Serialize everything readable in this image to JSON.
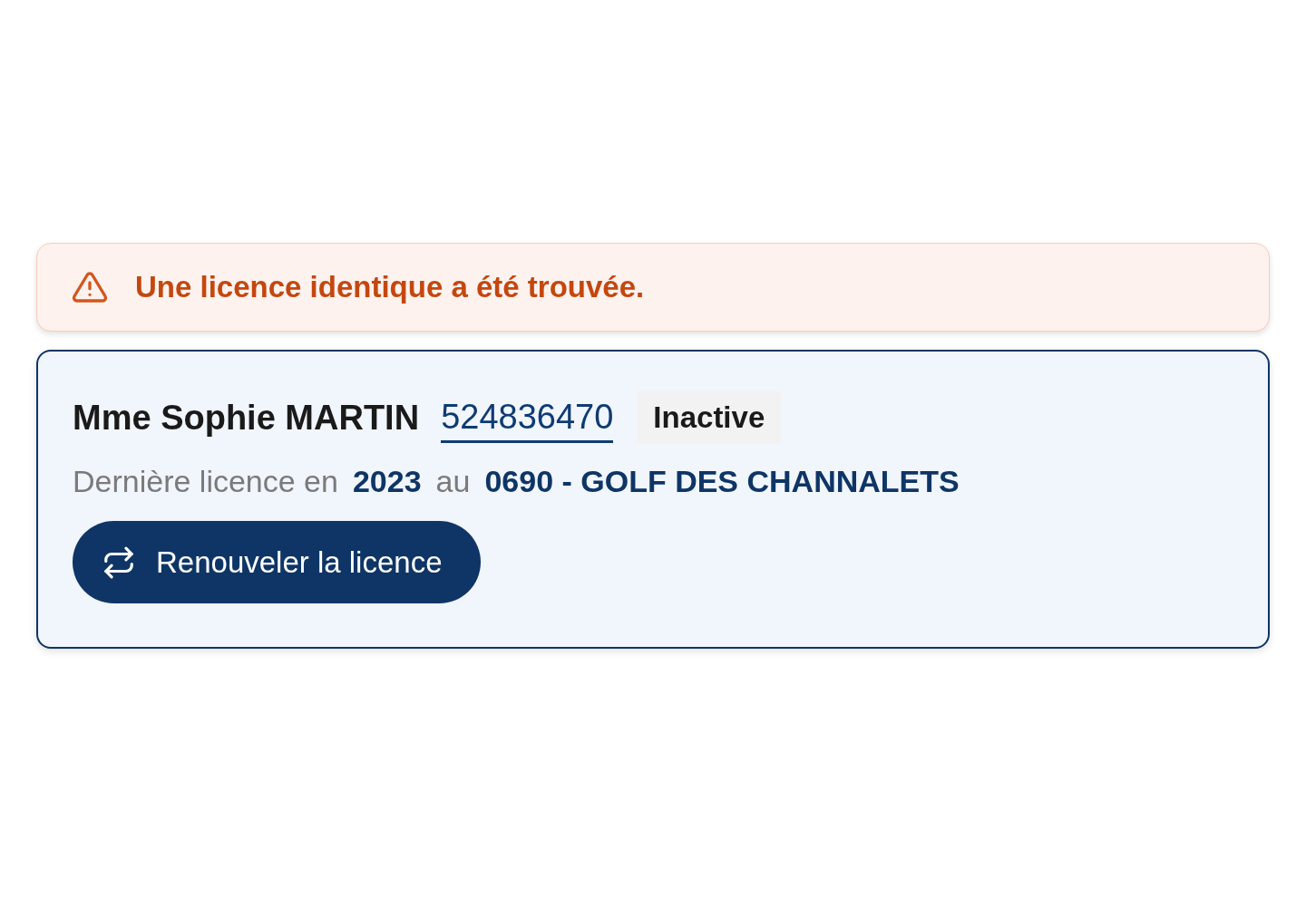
{
  "alert": {
    "message": "Une licence identique a été trouvée."
  },
  "license": {
    "name": "Mme Sophie MARTIN",
    "number": "524836470",
    "status": "Inactive",
    "last_label": "Dernière licence en",
    "year": "2023",
    "at_label": "au",
    "club": "0690 - GOLF DES CHANNALETS",
    "button": "Renouveler la licence"
  }
}
